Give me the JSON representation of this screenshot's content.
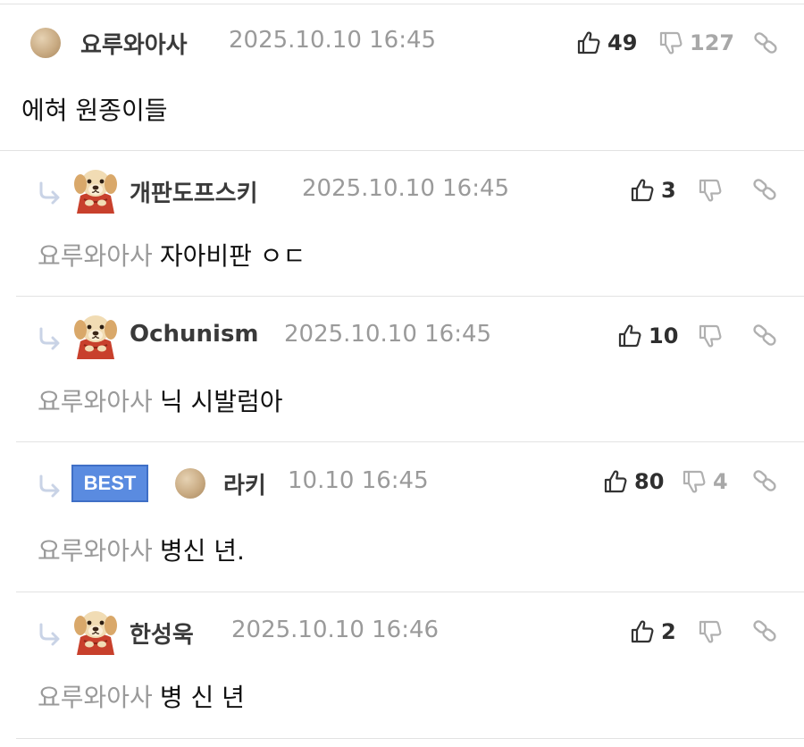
{
  "comments": [
    {
      "author": "요루와아사",
      "date": "2025.10.10 16:45",
      "up": "49",
      "down": "127",
      "mention": "",
      "text": "에혀 원종이들"
    },
    {
      "author": "개판도프스키",
      "date": "2025.10.10 16:45",
      "up": "3",
      "down": "",
      "mention": "요루와아사",
      "text": "자아비판 ㅇㄷ"
    },
    {
      "author": "Ochunism",
      "date": "2025.10.10 16:45",
      "up": "10",
      "down": "",
      "mention": "요루와아사",
      "text": "닉 시발럼아"
    },
    {
      "author": "라키",
      "badge": "BEST",
      "date": "10.10 16:45",
      "up": "80",
      "down": "4",
      "mention": "요루와아사",
      "text": "병신 년."
    },
    {
      "author": "한성욱",
      "date": "2025.10.10 16:46",
      "up": "2",
      "down": "",
      "mention": "요루와아사",
      "text": "병 신 년"
    }
  ],
  "icons": {
    "thumbs_up": "thumbs-up-icon",
    "thumbs_down": "thumbs-down-icon",
    "link": "link-icon",
    "reply": "reply-arrow-icon",
    "avatar_ball": "avatar-ball-icon",
    "avatar_dog": "avatar-puppy-icon"
  },
  "colors": {
    "best_badge": "#5a8be0",
    "date": "#9a9a9a",
    "mention": "#9a9a9a",
    "divider": "#e2e2e2"
  }
}
